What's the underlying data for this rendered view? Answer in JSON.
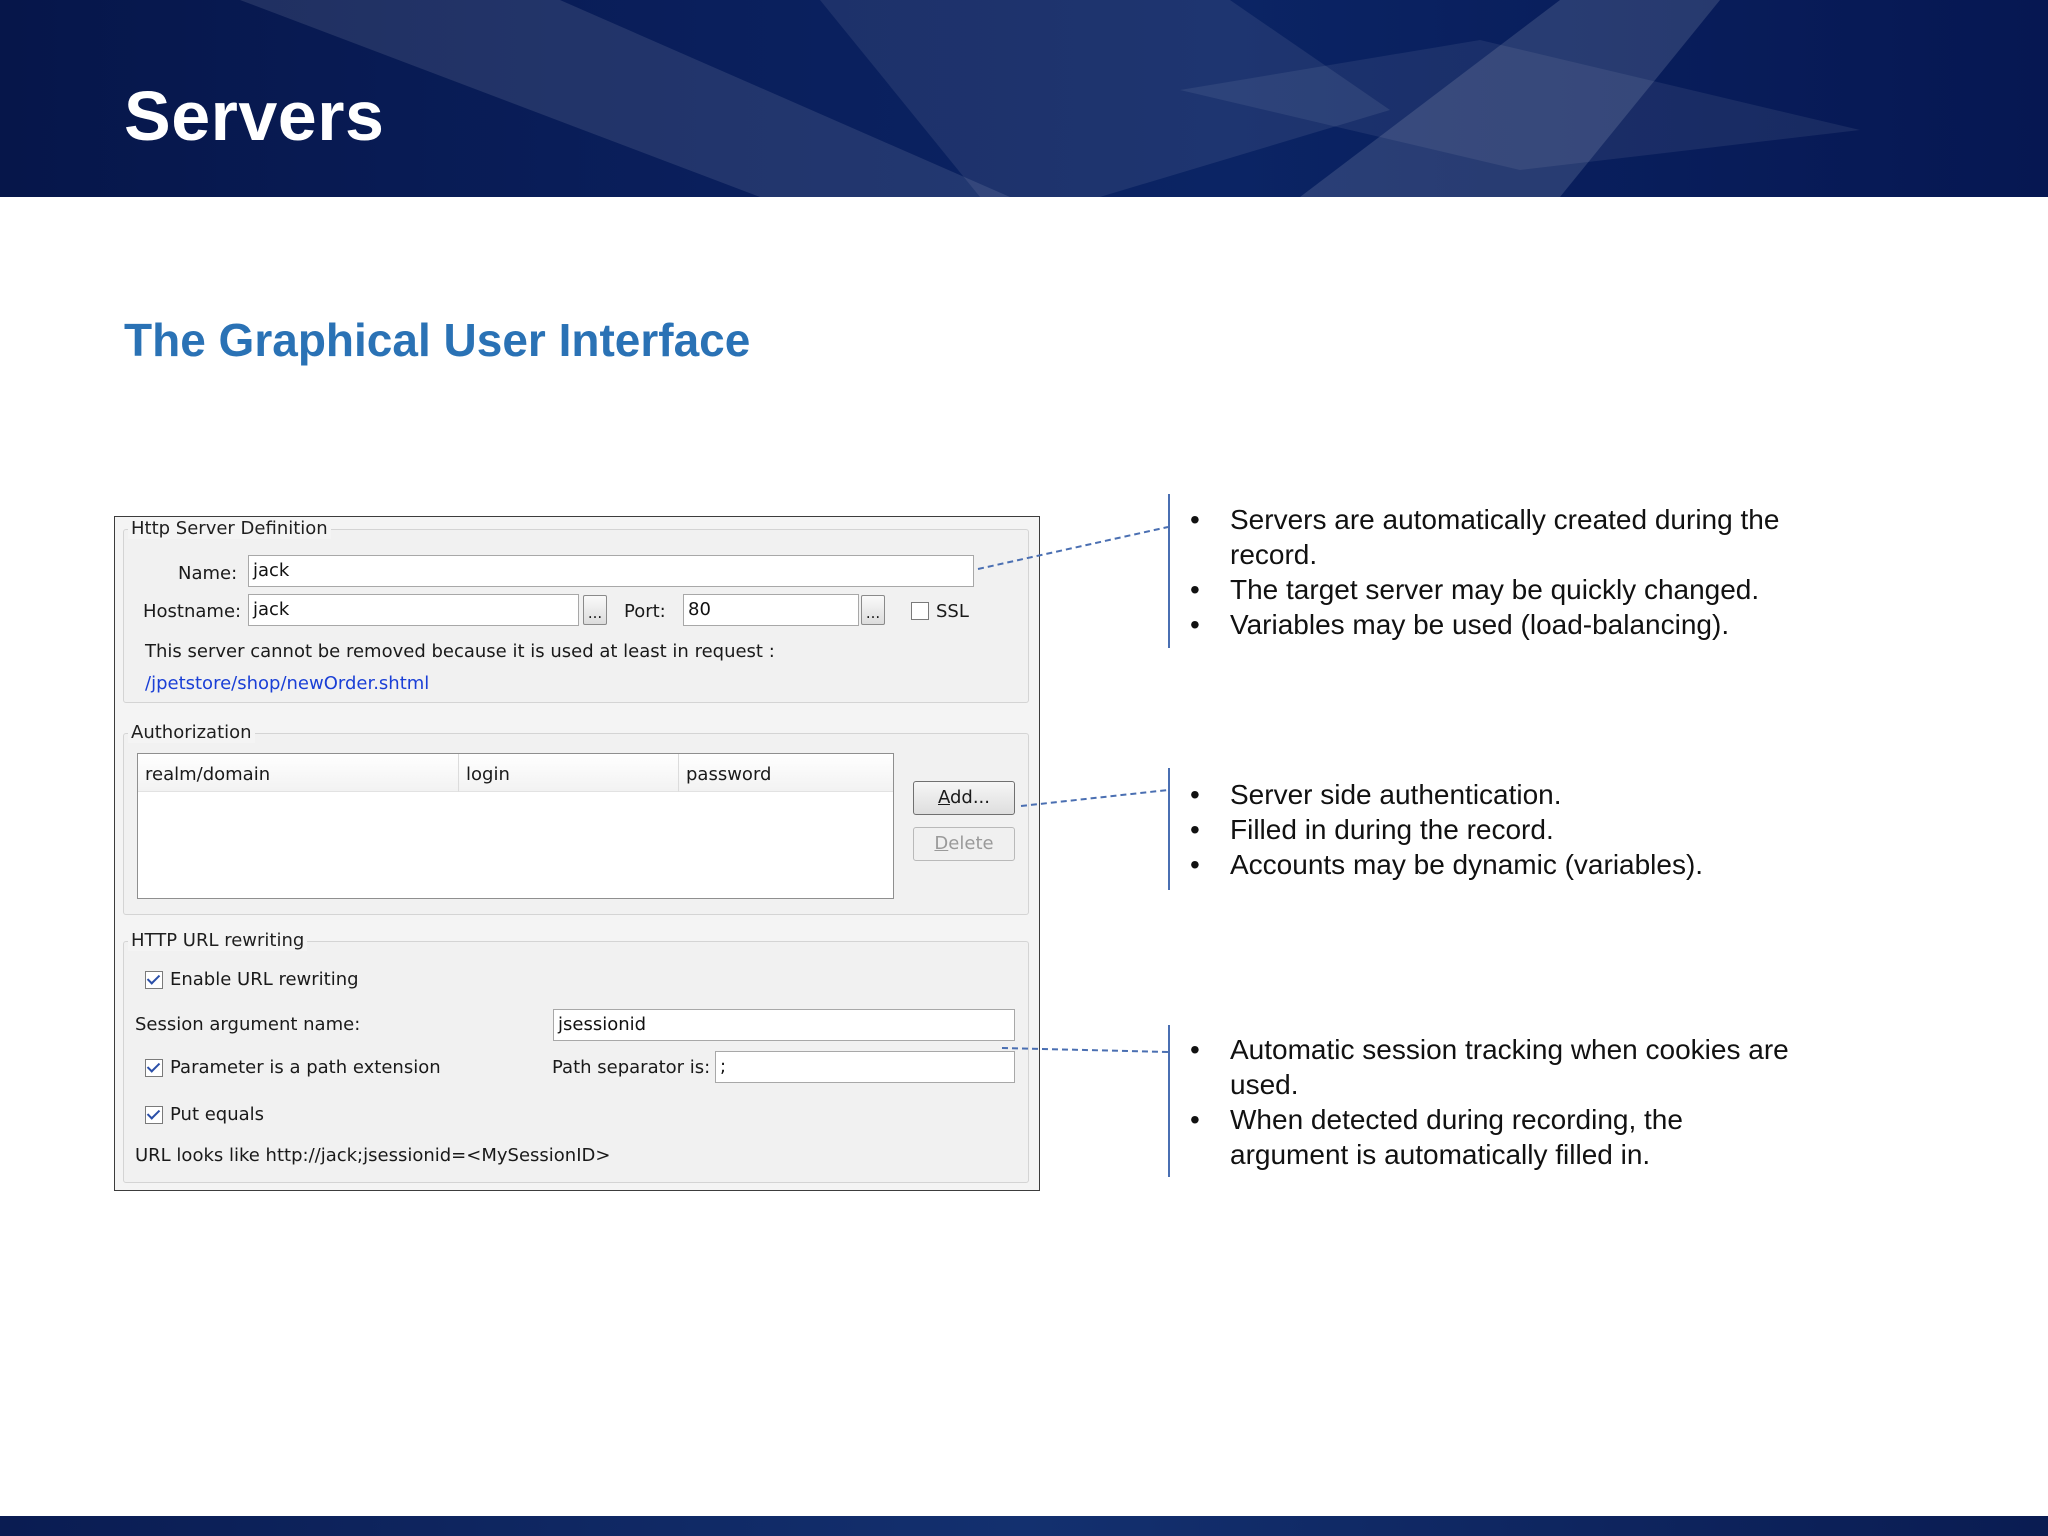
{
  "slide": {
    "title": "Servers",
    "subtitle": "The Graphical User Interface"
  },
  "dialog": {
    "server_group": {
      "legend": "Http Server Definition",
      "name_label": "Name:",
      "name_value": "jack",
      "hostname_label": "Hostname:",
      "hostname_value": "jack",
      "ellipsis": "...",
      "port_label": "Port:",
      "port_value": "80",
      "ssl_label": "SSL",
      "ssl_checked": false,
      "notice": "This server cannot be removed because it is used at least in request :",
      "request_link": "/jpetstore/shop/newOrder.shtml"
    },
    "auth_group": {
      "legend": "Authorization",
      "columns": [
        "realm/domain",
        "login",
        "password"
      ],
      "add_label": "Add...",
      "delete_label": "Delete"
    },
    "rewrite_group": {
      "legend": "HTTP URL rewriting",
      "enable_label": "Enable URL rewriting",
      "enable_checked": true,
      "session_arg_label": "Session argument name:",
      "session_arg_value": "jsessionid",
      "path_ext_label": "Parameter is a path extension",
      "path_ext_checked": true,
      "path_sep_label": "Path separator is:",
      "path_sep_value": ";",
      "put_equals_label": "Put equals",
      "put_equals_checked": true,
      "url_preview": "URL looks like http://jack;jsessionid=<MySessionID>"
    }
  },
  "notes": {
    "server": [
      "Servers are automatically created during the record.",
      "The target server may be quickly changed.",
      "Variables may be used (load-balancing)."
    ],
    "auth": [
      "Server side authentication.",
      "Filled in during the record.",
      "Accounts may be dynamic (variables)."
    ],
    "rewrite": [
      "Automatic session tracking when cookies are used.",
      "When detected during recording, the argument is automatically filled in."
    ]
  },
  "colors": {
    "header_navy": "#0a1f5c",
    "subtitle_blue": "#2a72b5",
    "link_blue": "#1a3fd6",
    "connector_blue": "#4a6fb2"
  }
}
